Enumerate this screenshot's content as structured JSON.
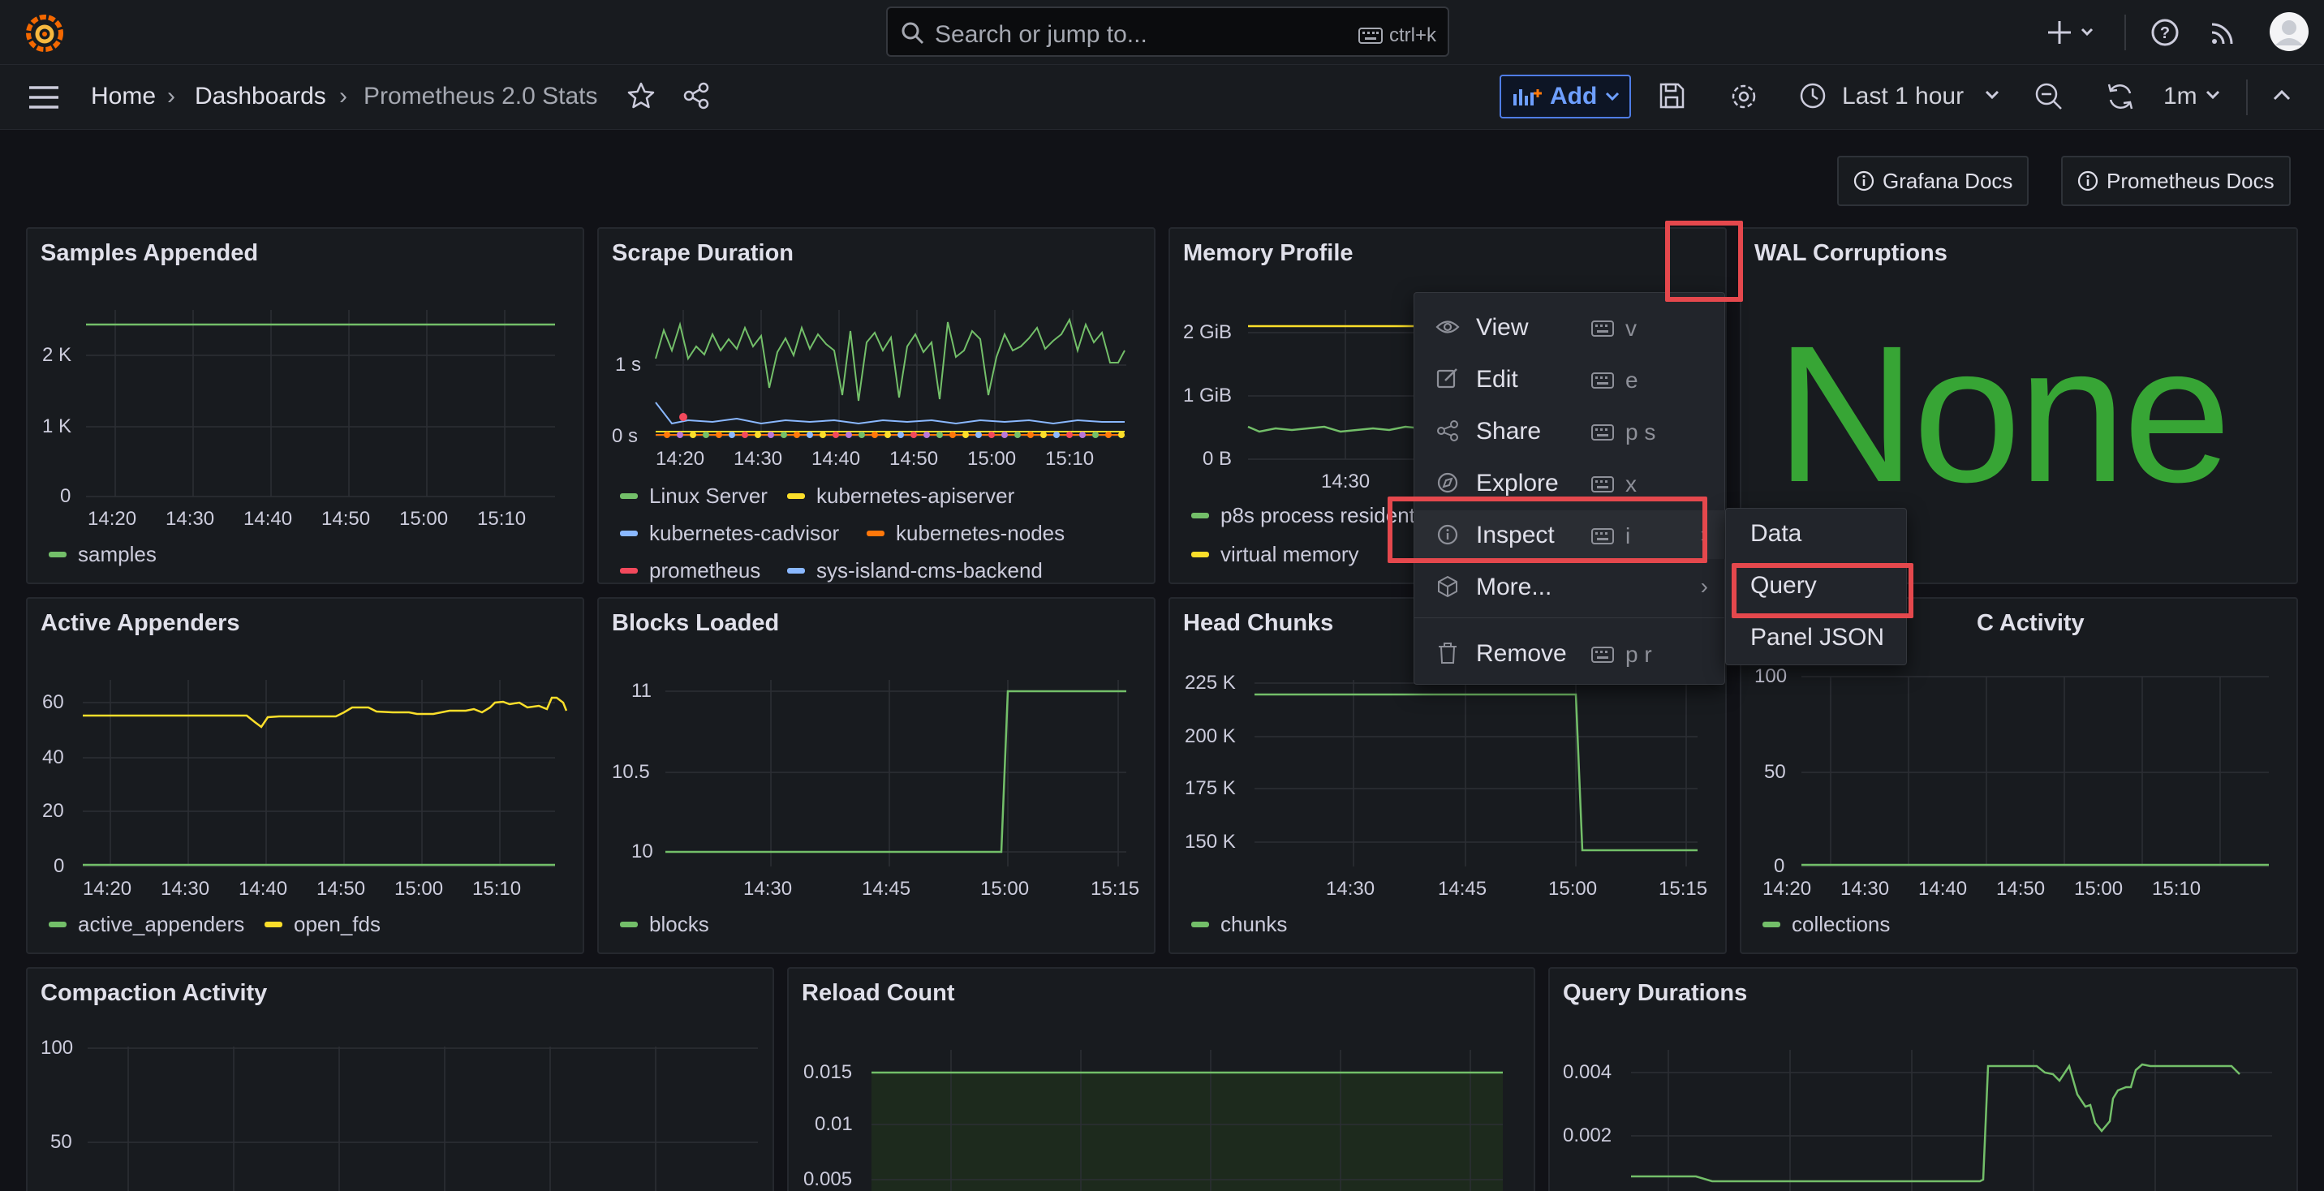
{
  "topbar": {
    "search_placeholder": "Search or jump to...",
    "search_shortcut": "ctrl+k"
  },
  "breadcrumb": {
    "home": "Home",
    "dashboards": "Dashboards",
    "current": "Prometheus 2.0 Stats"
  },
  "toolbar": {
    "add_label": "Add",
    "time_range": "Last 1 hour",
    "refresh_interval": "1m"
  },
  "links": {
    "grafana_docs": "Grafana Docs",
    "prometheus_docs": "Prometheus Docs"
  },
  "panels": {
    "samples_appended": {
      "title": "Samples Appended",
      "y_ticks": [
        "2 K",
        "1 K",
        "0"
      ],
      "x_ticks": [
        "14:20",
        "14:30",
        "14:40",
        "14:50",
        "15:00",
        "15:10"
      ],
      "legend": [
        "samples"
      ]
    },
    "scrape_duration": {
      "title": "Scrape Duration",
      "y_ticks": [
        "1 s",
        "0 s"
      ],
      "x_ticks": [
        "14:20",
        "14:30",
        "14:40",
        "14:50",
        "15:00",
        "15:10"
      ],
      "legend": [
        "Linux Server",
        "kubernetes-apiserver",
        "kubernetes-cadvisor",
        "kubernetes-nodes",
        "prometheus",
        "sys-island-cms-backend"
      ]
    },
    "memory_profile": {
      "title": "Memory Profile",
      "y_ticks": [
        "2 GiB",
        "1 GiB",
        "0 B"
      ],
      "x_ticks": [
        "14:30"
      ],
      "legend": [
        "p8s process resident memory",
        "virtual memory"
      ]
    },
    "wal_corruptions": {
      "title": "WAL Corruptions",
      "value": "None"
    },
    "active_appenders": {
      "title": "Active Appenders",
      "y_ticks": [
        "60",
        "40",
        "20",
        "0"
      ],
      "x_ticks": [
        "14:20",
        "14:30",
        "14:40",
        "14:50",
        "15:00",
        "15:10"
      ],
      "legend": [
        "active_appenders",
        "open_fds"
      ]
    },
    "blocks_loaded": {
      "title": "Blocks Loaded",
      "y_ticks": [
        "11",
        "10.5",
        "10"
      ],
      "x_ticks": [
        "14:30",
        "14:45",
        "15:00",
        "15:15"
      ],
      "legend": [
        "blocks"
      ]
    },
    "head_chunks": {
      "title": "Head Chunks",
      "y_ticks": [
        "225 K",
        "200 K",
        "175 K",
        "150 K"
      ],
      "x_ticks": [
        "14:30",
        "14:45",
        "15:00",
        "15:15"
      ],
      "legend": [
        "chunks"
      ]
    },
    "gc_activity": {
      "title": "C Activity",
      "y_ticks": [
        "100",
        "50",
        "0"
      ],
      "x_ticks": [
        "14:20",
        "14:30",
        "14:40",
        "14:50",
        "15:00",
        "15:10"
      ],
      "legend": [
        "collections"
      ]
    },
    "compaction_activity": {
      "title": "Compaction Activity",
      "y_ticks": [
        "100",
        "50"
      ]
    },
    "reload_count": {
      "title": "Reload Count",
      "y_ticks": [
        "0.015",
        "0.01",
        "0.005"
      ]
    },
    "query_durations": {
      "title": "Query Durations",
      "y_ticks": [
        "0.004",
        "0.002"
      ]
    }
  },
  "panel_menu": {
    "items": [
      {
        "label": "View",
        "key": "v"
      },
      {
        "label": "Edit",
        "key": "e"
      },
      {
        "label": "Share",
        "key": "p s"
      },
      {
        "label": "Explore",
        "key": "x"
      },
      {
        "label": "Inspect",
        "key": "i"
      },
      {
        "label": "More...",
        "key": ""
      },
      {
        "label": "Remove",
        "key": "p r"
      }
    ],
    "inspect_submenu": [
      "Data",
      "Query",
      "Panel JSON"
    ]
  },
  "colors": {
    "green": "#73bf69",
    "yellow": "#fade2a",
    "blue": "#8ab8ff",
    "orange": "#ff780a",
    "red": "#f2495c",
    "purple": "#b877d9",
    "stat_green": "#37a535",
    "highlight": "#e5484d",
    "accent": "#6e9fff"
  },
  "icons": [
    "grafana-logo-icon",
    "search-icon",
    "keyboard-icon",
    "plus-icon",
    "help-icon",
    "rss-icon",
    "avatar",
    "menu-icon",
    "star-icon",
    "share-icon",
    "add-panel-icon",
    "save-icon",
    "settings-icon",
    "clock-icon",
    "zoom-out-icon",
    "refresh-icon",
    "collapse-icon",
    "info-icon",
    "eye-icon",
    "edit-icon",
    "explore-icon",
    "cube-icon",
    "trash-icon"
  ]
}
